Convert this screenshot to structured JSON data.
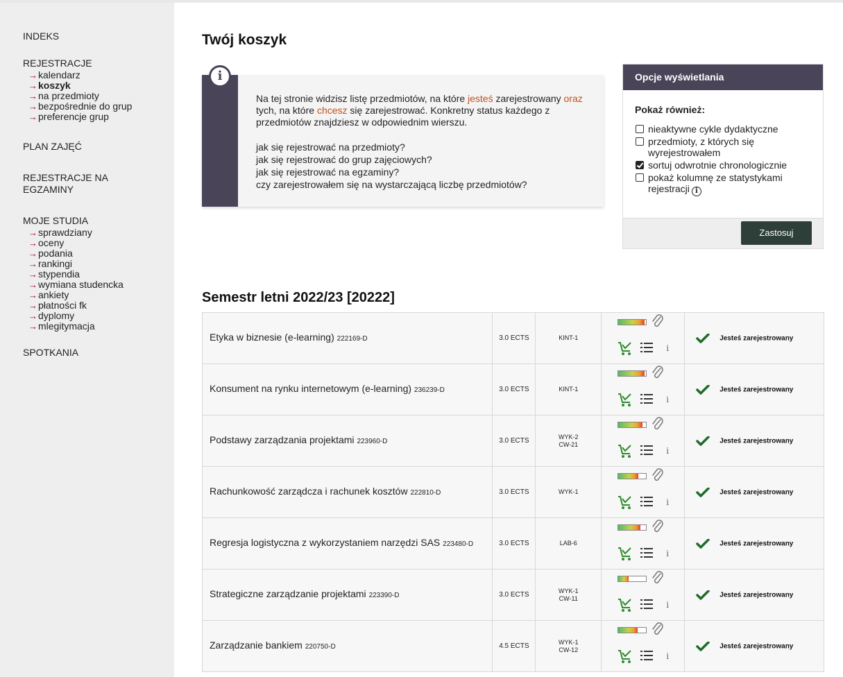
{
  "sidebar": {
    "indeks": "INDEKS",
    "rejestracje": {
      "head": "REJESTRACJE",
      "items": [
        "kalendarz",
        "koszyk",
        "na przedmioty",
        "bezpośrednie do grup",
        "preferencje grup"
      ]
    },
    "plan": "PLAN ZAJĘĆ",
    "rej_egz_1": "REJESTRACJE NA",
    "rej_egz_2": "EGZAMINY",
    "studia": {
      "head": "MOJE STUDIA",
      "items": [
        "sprawdziany",
        "oceny",
        "podania",
        "rankingi",
        "stypendia",
        "wymiana studencka",
        "ankiety",
        "płatności fk",
        "dyplomy",
        "mlegitymacja"
      ]
    },
    "spotkania": "SPOTKANIA",
    "arrow": "→"
  },
  "page": {
    "title": "Twój koszyk"
  },
  "info": {
    "icon": "i",
    "p1": "Na tej stronie widzisz listę przedmiotów, na które ",
    "p1_hl1": "jesteś",
    "p2": " zarejestrowany ",
    "p2_hl2": "oraz",
    "p3": " tych, na które ",
    "p3_hl3": "chcesz",
    "p4": " się zarejestrować. Konkretny status każdego z przedmiotów znajdziesz w odpowiednim wierszu.",
    "links": [
      "jak się rejestrować na przedmioty?",
      "jak się rejestrować do grup zajęciowych?",
      "jak się rejestrować na egzaminy?",
      "czy zarejestrowałem się na wystarczającą liczbę przedmiotów?"
    ]
  },
  "options": {
    "header": "Opcje wyświetlania",
    "label": "Pokaż również:",
    "items": [
      {
        "text": "nieaktywne cykle dydaktyczne",
        "checked": false
      },
      {
        "text": "przedmioty, z których się wyrejestrowałem",
        "checked": false
      },
      {
        "text": "sortuj odwrotnie chronologicznie",
        "checked": true
      },
      {
        "text": "pokaż kolumnę ze statystykami rejestracji",
        "checked": false
      }
    ],
    "info_icon": "i",
    "button": "Zastosuj"
  },
  "semester": {
    "title": "Semestr letni 2022/23 [20222]",
    "status_label": "Jesteś zarejestrowany",
    "courses": [
      {
        "name": "Etyka w biznesie (e-learning)",
        "code": "222169-D",
        "ects": "3.0 ECTS",
        "groups": [
          "KINT-1"
        ],
        "fill": 0.95
      },
      {
        "name": "Konsument na rynku internetowym (e-learning)",
        "code": "236239-D",
        "ects": "3.0 ECTS",
        "groups": [
          "KINT-1"
        ],
        "fill": 0.95
      },
      {
        "name": "Podstawy zarządzania projektami",
        "code": "223960-D",
        "ects": "3.0 ECTS",
        "groups": [
          "WYK-2",
          "CW-21"
        ],
        "fill": 0.88
      },
      {
        "name": "Rachunkowość zarządcza i rachunek kosztów",
        "code": "222810-D",
        "ects": "3.0 ECTS",
        "groups": [
          "WYK-1"
        ],
        "fill": 0.72
      },
      {
        "name": "Regresja logistyczna z wykorzystaniem narzędzi SAS",
        "code": "223480-D",
        "ects": "3.0 ECTS",
        "groups": [
          "LAB-6"
        ],
        "fill": 0.8
      },
      {
        "name": "Strategiczne zarządzanie projektami",
        "code": "223390-D",
        "ects": "3.0 ECTS",
        "groups": [
          "WYK-1",
          "CW-11"
        ],
        "fill": 0.38
      },
      {
        "name": "Zarządzanie bankiem",
        "code": "220750-D",
        "ects": "4.5 ECTS",
        "groups": [
          "WYK-1",
          "CW-12"
        ],
        "fill": 0.7
      }
    ]
  }
}
